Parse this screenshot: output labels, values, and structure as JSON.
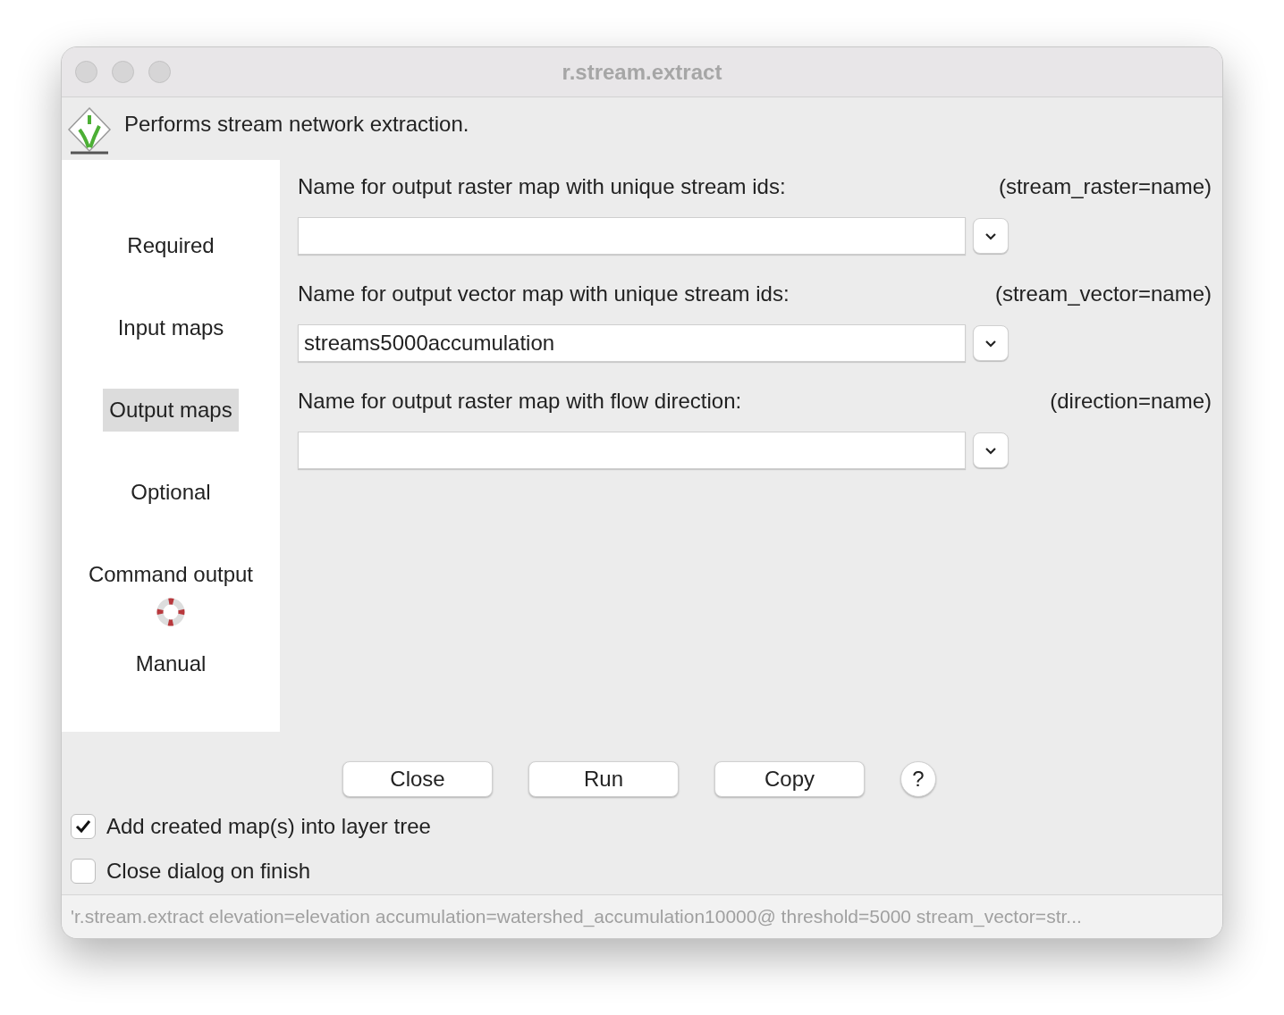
{
  "window": {
    "title": "r.stream.extract"
  },
  "description": "Performs stream network extraction.",
  "tabs": [
    {
      "label": "Required",
      "selected": false,
      "kind": "text"
    },
    {
      "label": "Input maps",
      "selected": false,
      "kind": "text"
    },
    {
      "label": "Output maps",
      "selected": true,
      "kind": "text"
    },
    {
      "label": "Optional",
      "selected": false,
      "kind": "text"
    },
    {
      "label": "Command output",
      "selected": false,
      "kind": "text"
    },
    {
      "label": "Manual",
      "selected": false,
      "kind": "icon"
    }
  ],
  "fields": [
    {
      "label": "Name for output raster map with unique stream ids:",
      "parameter": "(stream_raster=name)"
    },
    {
      "label": "Name for output vector map with unique stream ids:",
      "parameter": "(stream_vector=name)",
      "value": "streams5000accumulation"
    },
    {
      "label": "Name for output raster map with flow direction:",
      "parameter": "(direction=name)"
    }
  ],
  "buttons": [
    "Close",
    "Run",
    "Copy"
  ],
  "help_button": "?",
  "options": [
    {
      "label": "Add created map(s) into layer tree",
      "checked": true
    },
    {
      "label": "Close dialog on finish",
      "checked": false
    }
  ],
  "status_bar": "'r.stream.extract elevation=elevation accumulation=watershed_accumulation10000@ threshold=5000 stream_vector=str..."
}
